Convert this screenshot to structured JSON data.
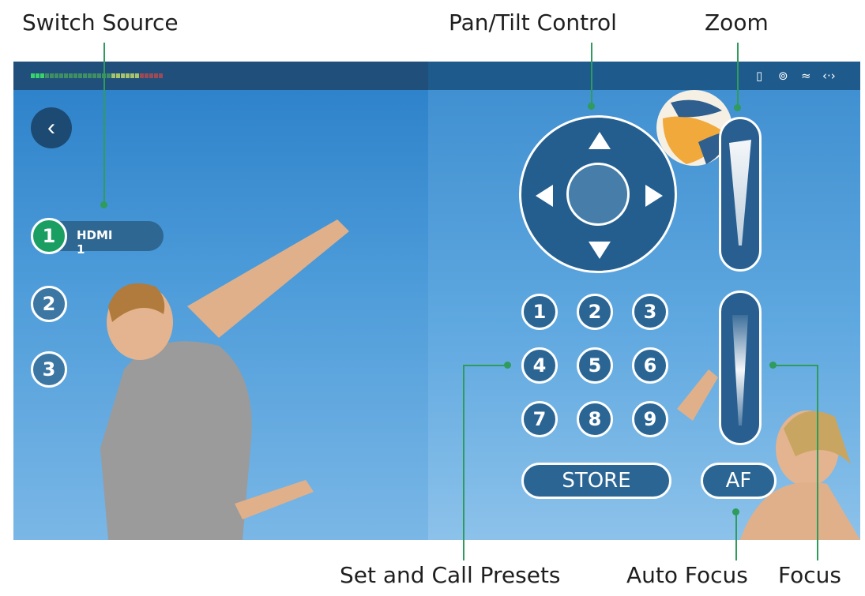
{
  "callouts": {
    "switch_source": "Switch Source",
    "pan_tilt": "Pan/Tilt Control",
    "zoom": "Zoom",
    "presets": "Set and Call Presets",
    "auto_focus": "Auto Focus",
    "focus": "Focus"
  },
  "status_bar": {
    "icons": [
      "sd-card-icon",
      "power-plug-icon",
      "wifi-icon",
      "network-code-icon"
    ]
  },
  "sources": [
    {
      "number": "1",
      "label": "HDMI 1",
      "active": true
    },
    {
      "number": "2",
      "label": "",
      "active": false
    },
    {
      "number": "3",
      "label": "",
      "active": false
    }
  ],
  "presets": [
    "1",
    "2",
    "3",
    "4",
    "5",
    "6",
    "7",
    "8",
    "9"
  ],
  "buttons": {
    "store": "STORE",
    "af": "AF"
  },
  "colors": {
    "accent_green": "#2f9b5c",
    "active_source": "#1a9e62",
    "control_fill": "#2a6594"
  }
}
